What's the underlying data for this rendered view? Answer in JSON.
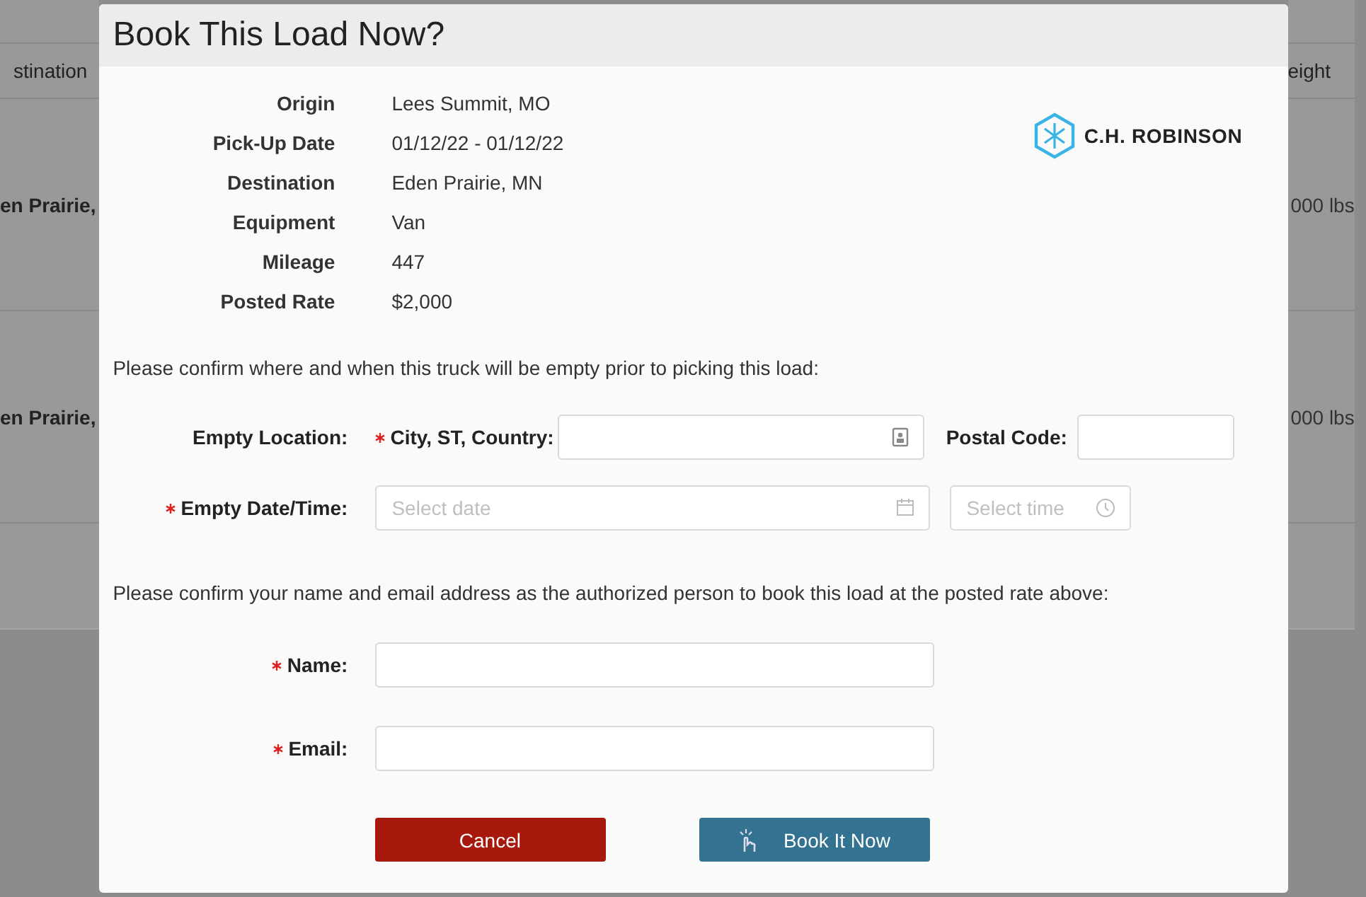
{
  "background_table": {
    "left_header": "stination",
    "right_header": "eight",
    "left_cells": [
      "en Prairie,",
      "en Prairie,"
    ],
    "right_cells": [
      "000 lbs",
      "000 lbs"
    ]
  },
  "dialog": {
    "title": "Book This Load Now?",
    "details": [
      {
        "label": "Origin",
        "value": "Lees Summit, MO"
      },
      {
        "label": "Pick-Up Date",
        "value": "01/12/22 - 01/12/22"
      },
      {
        "label": "Destination",
        "value": "Eden Prairie, MN"
      },
      {
        "label": "Equipment",
        "value": "Van"
      },
      {
        "label": "Mileage",
        "value": "447"
      },
      {
        "label": "Posted Rate",
        "value": "$2,000"
      }
    ],
    "logo": "C.H. ROBINSON",
    "location_prompt": "Please confirm where and when this truck will be empty prior to picking this load:",
    "empty_location": {
      "label": "Empty Location:",
      "required": false,
      "city": {
        "label": "City, ST, Country:",
        "required": true
      },
      "postal": {
        "label": "Postal Code:",
        "required": false
      }
    },
    "empty_datetime": {
      "label": "Empty Date/Time:",
      "required": true,
      "date_placeholder": "Select date",
      "time_placeholder": "Select time"
    },
    "contact_prompt": "Please confirm your name and email address as the authorized person to book this load at the posted rate above:",
    "contact_fields": [
      {
        "label": "Name:",
        "required": true
      },
      {
        "label": "Email:",
        "required": true
      }
    ],
    "buttons": [
      {
        "kind": "cancel",
        "label": "Cancel"
      },
      {
        "kind": "book",
        "label": "Book It Now"
      }
    ]
  }
}
